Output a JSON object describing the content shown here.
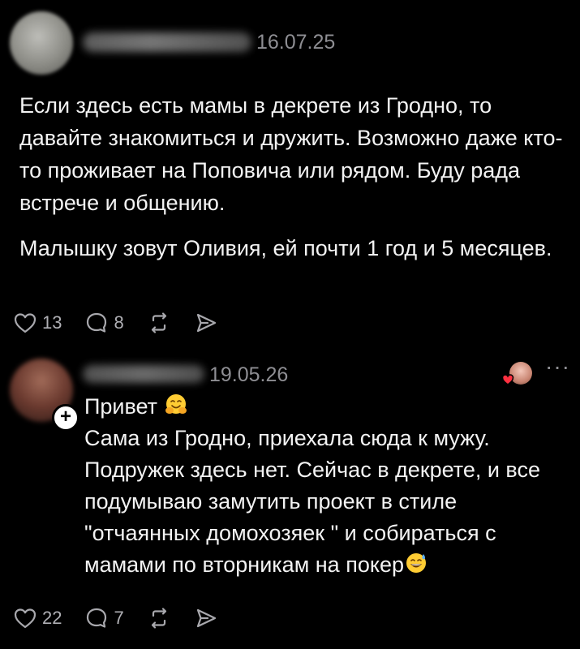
{
  "posts": [
    {
      "date": "16.07.25",
      "paragraphs": [
        "Если здесь есть мамы в декрете из Гродно, то давайте знакомиться и дружить. Возможно даже кто-то проживает на Поповича или рядом. Буду рада встрече и общению.",
        "Малышку зовут Оливия, ей почти 1 год и 5 месяцев."
      ],
      "likes": "13",
      "comments": "8"
    },
    {
      "date": "19.05.26",
      "greeting": "Привет",
      "body": "Сама из Гродно, приехала сюда к мужу. Подружек здесь нет. Сейчас в декрете, и все подумываю замутить проект в стиле \"отчаянных домохозяек \" и собираться с мамами по вторникам на покер",
      "likes": "22",
      "comments": "7",
      "more": "···"
    }
  ],
  "icons": {
    "like": "heart-icon",
    "comment": "comment-bubble-icon",
    "repost": "repost-icon",
    "share": "send-icon",
    "follow": "plus-icon",
    "greeting_emoji": "hugging-face-emoji",
    "end_emoji": "sweat-smile-emoji"
  },
  "colors": {
    "background": "#000000",
    "text": "#f3f3f3",
    "meta": "#8e8e93"
  }
}
